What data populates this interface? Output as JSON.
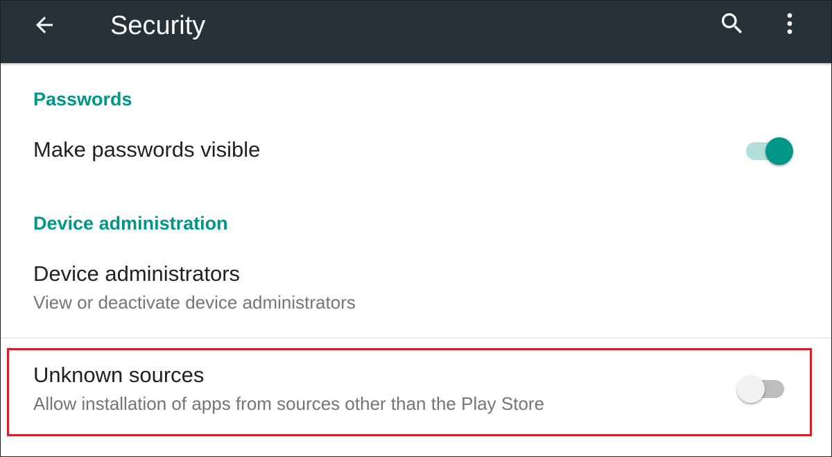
{
  "appbar": {
    "title": "Security",
    "back_icon": "arrow-back-icon",
    "search_icon": "search-icon",
    "more_icon": "more-vert-icon",
    "background_color": "#263238"
  },
  "accent_color": "#009688",
  "sections": {
    "passwords": {
      "header": "Passwords",
      "make_passwords_visible": {
        "title": "Make passwords visible",
        "toggle_state": "on"
      }
    },
    "device_administration": {
      "header": "Device administration",
      "device_administrators": {
        "title": "Device administrators",
        "summary": "View or deactivate device administrators"
      },
      "unknown_sources": {
        "title": "Unknown sources",
        "summary": "Allow installation of apps from sources other than the Play Store",
        "toggle_state": "off",
        "highlight_color": "#d42027"
      }
    }
  }
}
